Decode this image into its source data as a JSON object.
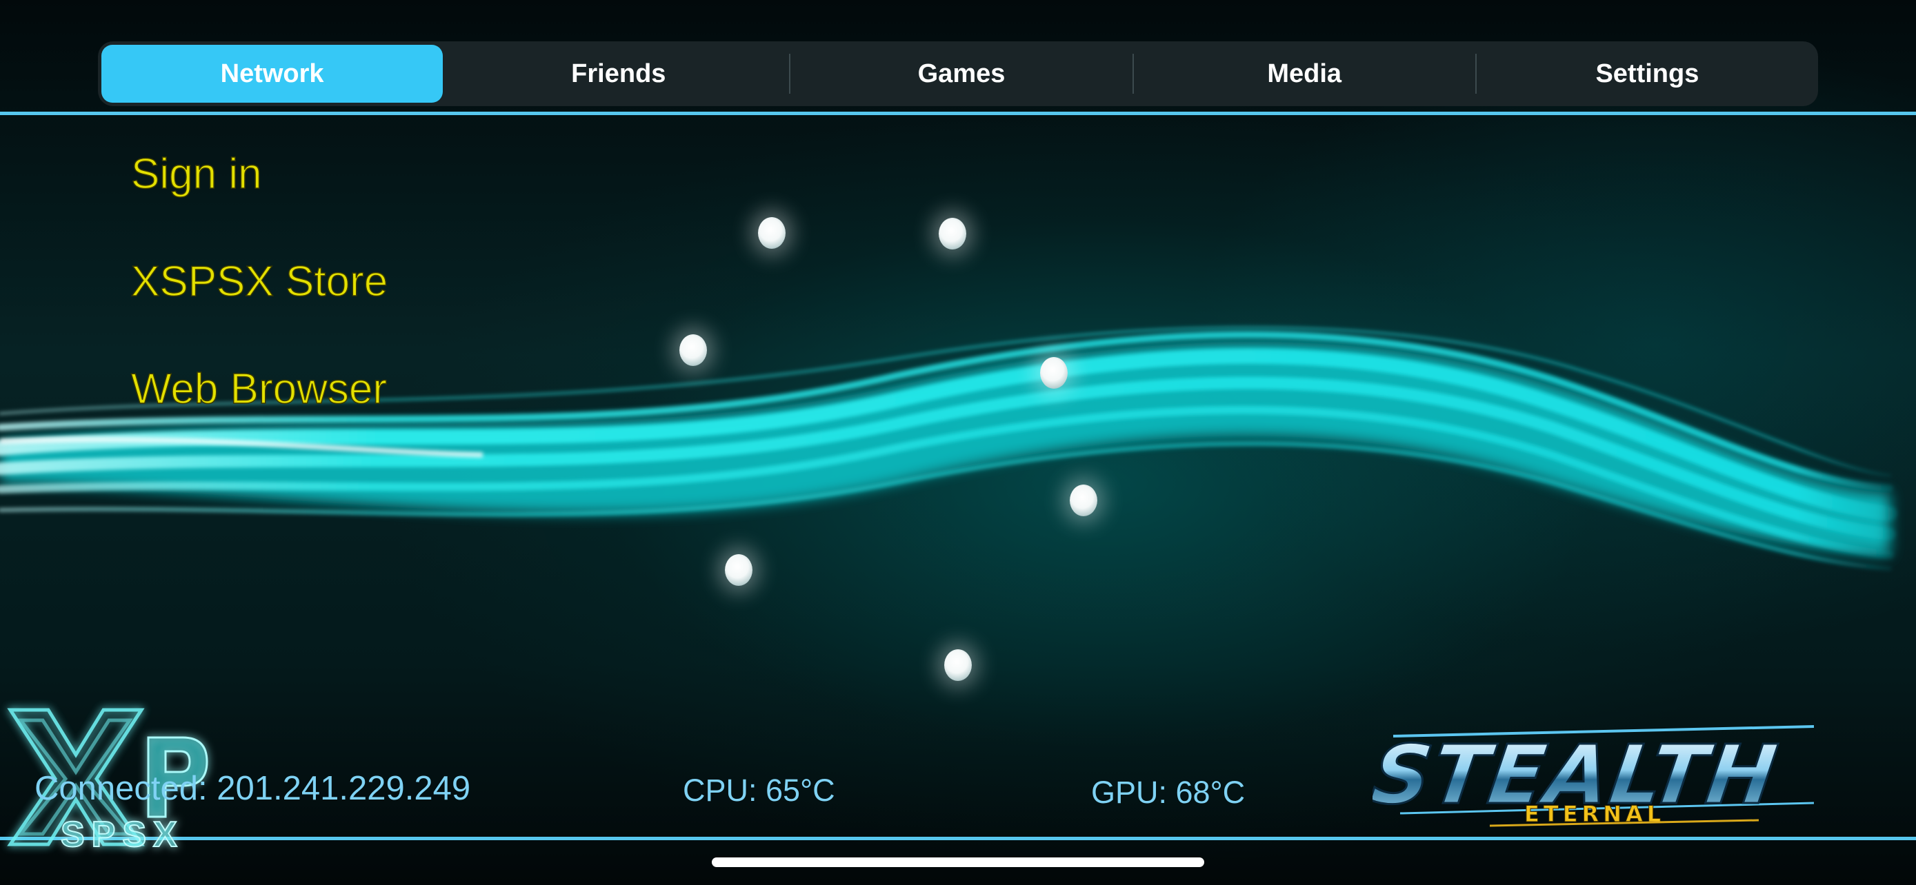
{
  "nav": {
    "tabs": [
      {
        "label": "Network",
        "active": true
      },
      {
        "label": "Friends",
        "active": false
      },
      {
        "label": "Games",
        "active": false
      },
      {
        "label": "Media",
        "active": false
      },
      {
        "label": "Settings",
        "active": false
      }
    ]
  },
  "menu": {
    "items": [
      {
        "label": "Sign in"
      },
      {
        "label": "XSPSX Store"
      },
      {
        "label": "Web Browser"
      }
    ]
  },
  "status": {
    "connected": "Connected: 201.241.229.249",
    "cpu": "CPU: 65°C",
    "gpu": "GPU: 68°C"
  },
  "logos": {
    "left_logo": {
      "main": "XP",
      "sub": "SPSX"
    },
    "right_logo": {
      "main": "STEALTH",
      "sub": "ETERNAL"
    }
  },
  "colors": {
    "accent": "#36c8f6",
    "menu_text": "#e3e000",
    "status_text": "#7fd2f4",
    "wave": "#19e6e6"
  }
}
